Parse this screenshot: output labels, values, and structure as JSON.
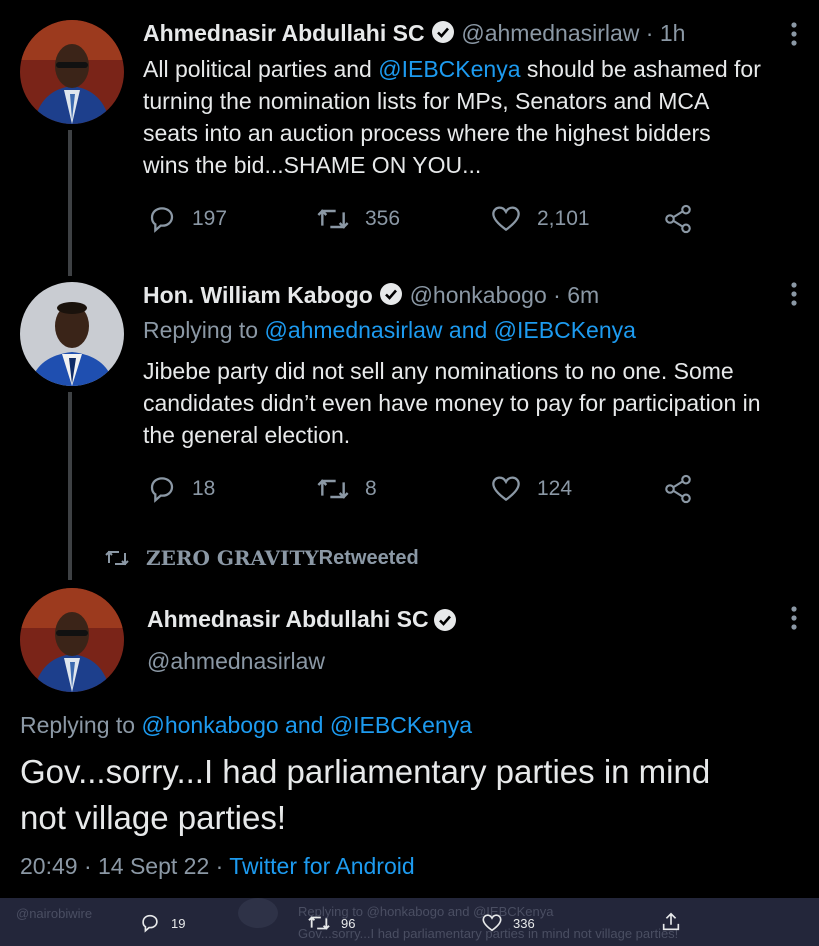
{
  "tweet1": {
    "name": "Ahmednasir Abdullahi SC",
    "handle": "@ahmednasirlaw",
    "time": "· 1h",
    "text_pre": "All political parties and ",
    "mention": "@IEBCKenya",
    "text_line1_post": " should be ashamed for",
    "text_line2": "turning the nomination lists for MPs, Senators and MCA",
    "text_line3": "seats into an auction process where the highest bidders",
    "text_line4": "wins the bid...SHAME ON YOU...",
    "replies": "197",
    "retweets": "356",
    "likes": "2,101"
  },
  "tweet2": {
    "name": "Hon. William Kabogo",
    "handle": "@honkabogo",
    "time": "· 6m",
    "replying_prefix": "Replying to ",
    "replying_user1": "@ahmednasirlaw",
    "replying_and": " and ",
    "replying_user2": "@IEBCKenya",
    "text_line1": "Jibebe party did not sell any nominations to no one. Some",
    "text_line2": "candidates didn’t even have money to pay for participation in",
    "text_line3": "the general election.",
    "replies": "18",
    "retweets": "8",
    "likes": "124"
  },
  "retweeted_by": {
    "user": "ZERO GRAVITY",
    "label": " Retweeted"
  },
  "tweet3": {
    "name": "Ahmednasir Abdullahi SC",
    "handle": "@ahmednasirlaw",
    "replying_prefix": "Replying to ",
    "replying_user1": "@honkabogo",
    "replying_and": " and ",
    "replying_user2": "@IEBCKenya",
    "text_line1": "Gov...sorry...I had parliamentary parties in mind",
    "text_line2": "not village parties!",
    "timestamp": "20:49 · 14 Sept 22 · ",
    "source": "Twitter for Android"
  },
  "bottom_bar": {
    "ghost_handle": "@nairobiwire",
    "ghost_reply": "Replying to @honkabogo and @IEBCKenya",
    "ghost_text": "Gov...sorry...I had parliamentary parties in mind not village parties!",
    "replies": "19",
    "retweets": "96",
    "likes": "336"
  },
  "icons": {
    "reply": "reply-icon",
    "retweet": "retweet-icon",
    "like": "heart-icon",
    "share": "share-icon",
    "more": "more-icon",
    "verified": "verified-icon"
  },
  "colors": {
    "background": "#000000",
    "text": "#e7e9ea",
    "muted": "#8b98a5",
    "link": "#1d9bf0",
    "bottom_bar": "#23263a"
  }
}
